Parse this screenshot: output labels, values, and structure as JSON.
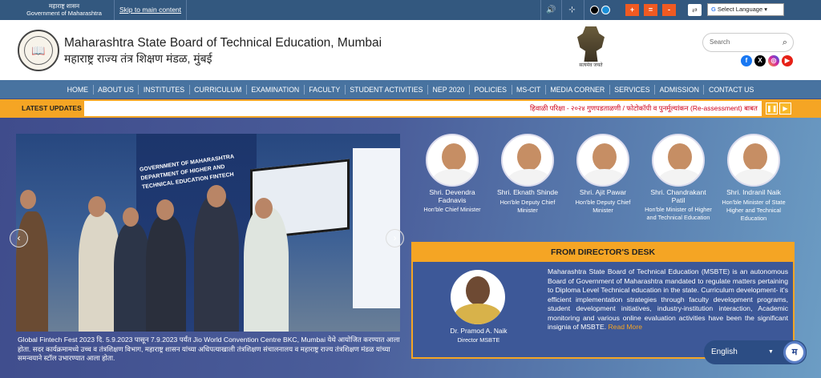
{
  "topbar": {
    "gov_line1": "महाराष्ट्र शासन",
    "gov_line2": "Government of Maharashtra",
    "skip_link": "Skip to main content",
    "language_select": "Select Language",
    "font_sizes": [
      "+",
      "=",
      "-"
    ]
  },
  "header": {
    "title_en": "Maharashtra State Board of Technical Education, Mumbai",
    "title_mr": "महाराष्ट्र राज्य तंत्र शिक्षण मंडळ, मुंबई",
    "emblem_caption": "सत्यमेव जयते",
    "search_placeholder": "Search",
    "social": [
      "facebook-icon",
      "x-icon",
      "instagram-icon",
      "youtube-icon"
    ]
  },
  "nav": {
    "items": [
      "HOME",
      "ABOUT US",
      "INSTITUTES",
      "CURRICULUM",
      "EXAMINATION",
      "FACULTY",
      "STUDENT ACTIVITIES",
      "NEP 2020",
      "POLICIES",
      "MS-CIT",
      "MEDIA CORNER",
      "SERVICES",
      "ADMISSION",
      "CONTACT US"
    ]
  },
  "latest": {
    "label": "LATEST UPDATES",
    "ticker": "हिवाळी परिक्षा - २०२४ गुणपडताळणी / फोटोकॉपी व पुनर्मूल्यांकन (Re-assessment) बाबत"
  },
  "slider": {
    "caption": "Global Fintech Fest 2023 दि. 5.9.2023 पासून 7.9.2023 पर्यंत Jio World Convention Centre BKC, Mumbai येथे आयोजित करण्यात आला होता. सदर कार्यक्रमामध्ये उच्च व तंत्रशिक्षण विभाग, महाराष्ट्र शासन यांच्या अधिपत्याखाली तंत्रशिक्षण संचालनालय व महाराष्ट्र राज्य तंत्रशिक्षण मंडळ यांच्या समन्वयाने स्टॉल उभारण्यात आला होता.",
    "banner_text": "GOVERNMENT OF MAHARASHTRA DEPARTMENT OF HIGHER AND TECHNICAL EDUCATION FINTECH"
  },
  "leaders": [
    {
      "name": "Shri. Devendra Fadnavis",
      "role": "Hon'ble Chief Minister"
    },
    {
      "name": "Shri. Eknath Shinde",
      "role": "Hon'ble Deputy Chief Minister"
    },
    {
      "name": "Shri. Ajit Pawar",
      "role": "Hon'ble Deputy Chief Minister"
    },
    {
      "name": "Shri. Chandrakant Patil",
      "role": "Hon'ble Minister of Higher and Technical Education"
    },
    {
      "name": "Shri. Indranil Naik",
      "role": "Hon'ble Minister of State Higher and Technical Education"
    }
  ],
  "director": {
    "heading": "FROM DIRECTOR'S DESK",
    "name": "Dr. Pramod A. Naik",
    "role": "Director MSBTE",
    "text": "Maharashtra State Board of Technical Education (MSBTE) is an autonomous Board of Government of Maharashtra mandated to regulate matters pertaining to Diploma Level Technical education in the state. Curriculum development- it's efficient implementation strategies through faculty development programs, student development initiatives, industry-institution interaction, Academic monitoring and various online evaluation activities have been the significant insignia of MSBTE.",
    "read_more": "Read More"
  },
  "language_widget": {
    "label": "English",
    "badge": "म"
  }
}
